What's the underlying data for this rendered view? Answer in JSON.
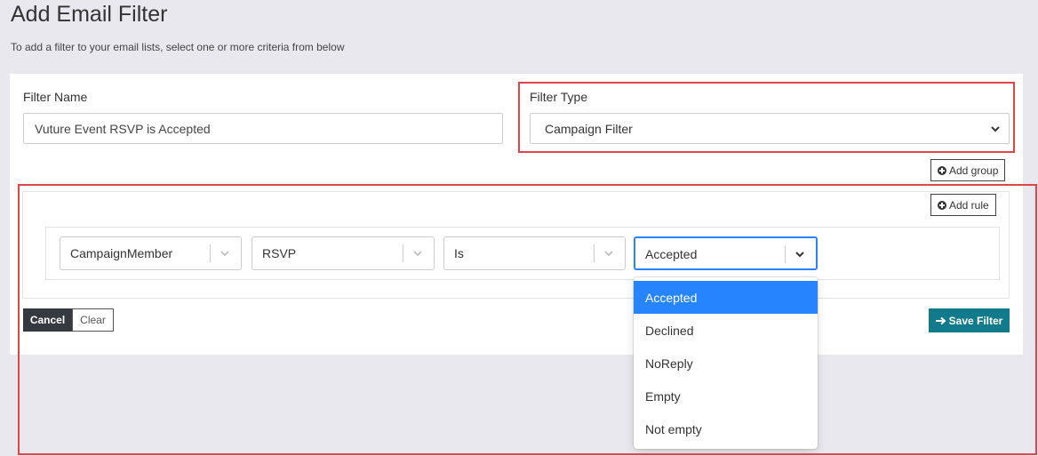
{
  "header": {
    "title": "Add Email Filter",
    "subtitle": "To add a filter to your email lists, select one or more criteria from below"
  },
  "filter_name": {
    "label": "Filter Name",
    "value": "Vuture Event RSVP is Accepted"
  },
  "filter_type": {
    "label": "Filter Type",
    "selected": "Campaign Filter"
  },
  "buttons": {
    "add_group": "Add group",
    "add_rule": "Add rule",
    "cancel": "Cancel",
    "clear": "Clear",
    "save_filter": "Save Filter"
  },
  "rule": {
    "field": "CampaignMember",
    "property": "RSVP",
    "operator": "Is",
    "value": "Accepted"
  },
  "value_options": [
    "Accepted",
    "Declined",
    "NoReply",
    "Empty",
    "Not empty"
  ],
  "colors": {
    "highlight": "#e0454b",
    "option_selected": "#2684ff",
    "save_button": "#117a8b",
    "cancel_button": "#343a40"
  },
  "icons": [
    "plus-circle-icon",
    "chevron-down-icon",
    "arrow-right-icon"
  ]
}
